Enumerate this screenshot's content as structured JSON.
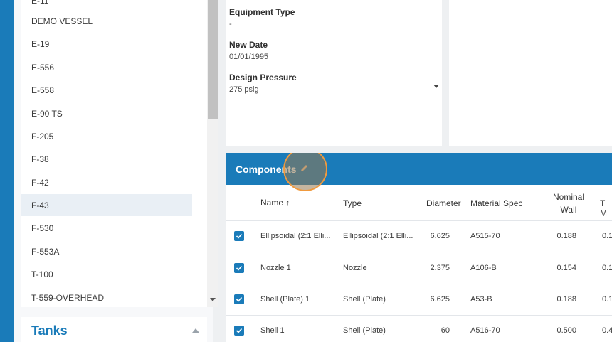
{
  "sidebar": {
    "assets": [
      {
        "label": "E-11"
      },
      {
        "label": "DEMO VESSEL"
      },
      {
        "label": "E-19"
      },
      {
        "label": "E-556"
      },
      {
        "label": "E-558"
      },
      {
        "label": "E-90 TS"
      },
      {
        "label": "F-205"
      },
      {
        "label": "F-38"
      },
      {
        "label": "F-42"
      },
      {
        "label": "F-43",
        "selected": true
      },
      {
        "label": "F-530"
      },
      {
        "label": "F-553A"
      },
      {
        "label": "T-100"
      },
      {
        "label": "T-559-OVERHEAD"
      }
    ],
    "tanks_label": "Tanks"
  },
  "details": {
    "fields": [
      {
        "label": "Equipment Type",
        "value": "-"
      },
      {
        "label": "New Date",
        "value": "01/01/1995"
      },
      {
        "label": "Design Pressure",
        "value": "275 psig"
      }
    ]
  },
  "components": {
    "title": "Components",
    "columns": {
      "name": "Name ↑",
      "type": "Type",
      "diameter": "Diameter",
      "material": "Material Spec",
      "nominal_wall_1": "Nominal",
      "nominal_wall_2": "Wall",
      "t_min": "T M"
    },
    "rows": [
      {
        "name": "Ellipsoidal (2:1 Elli...",
        "type": "Ellipsoidal (2:1 Elli...",
        "diameter": "6.625",
        "material": "A515-70",
        "nominal_wall": "0.188",
        "t_min": "0.1"
      },
      {
        "name": "Nozzle 1",
        "type": "Nozzle",
        "diameter": "2.375",
        "material": "A106-B",
        "nominal_wall": "0.154",
        "t_min": "0.1"
      },
      {
        "name": "Shell (Plate) 1",
        "type": "Shell (Plate)",
        "diameter": "6.625",
        "material": "A53-B",
        "nominal_wall": "0.188",
        "t_min": "0.1"
      },
      {
        "name": "Shell 1",
        "type": "Shell (Plate)",
        "diameter": "60",
        "material": "A516-70",
        "nominal_wall": "0.500",
        "t_min": "0.4"
      }
    ]
  },
  "colors": {
    "accent": "#1a7bb9",
    "highlight": "#f09a3e"
  }
}
